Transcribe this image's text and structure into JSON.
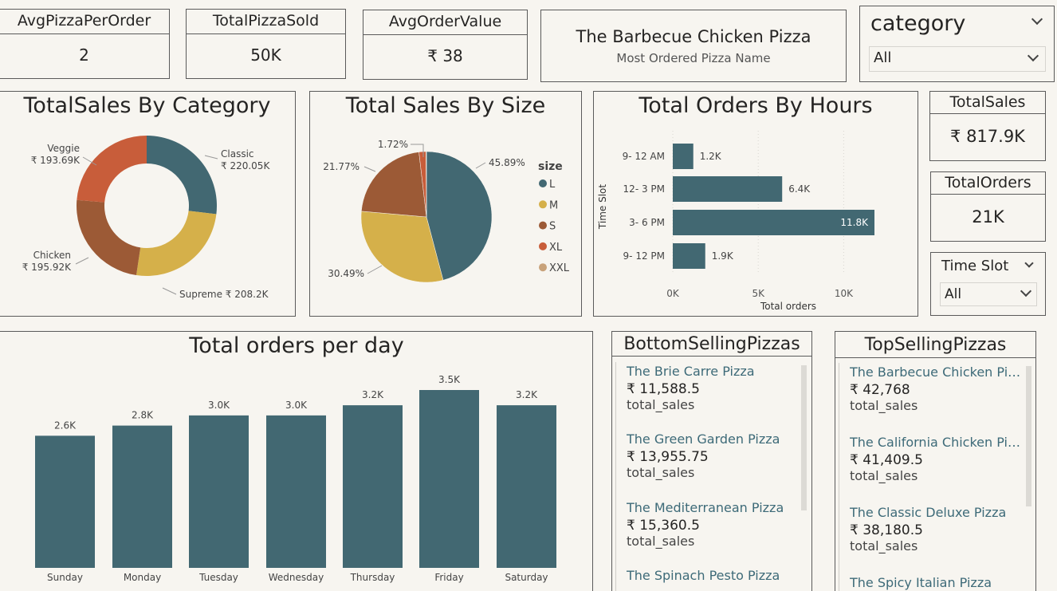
{
  "kpis": {
    "avg_pizza": {
      "label": "AvgPizzaPerOrder",
      "value": "2"
    },
    "total_pizza": {
      "label": "TotalPizzaSold",
      "value": "50K"
    },
    "avg_order": {
      "label": "AvgOrderValue",
      "value": "₹ 38"
    },
    "most_ordered": {
      "value": "The Barbecue Chicken Pizza",
      "label": "Most Ordered Pizza Name"
    },
    "total_sales": {
      "label": "TotalSales",
      "value": "₹ 817.9K"
    },
    "total_orders": {
      "label": "TotalOrders",
      "value": "21K"
    }
  },
  "filters": {
    "category": {
      "title": "category",
      "selected": "All"
    },
    "time_slot": {
      "title": "Time Slot",
      "selected": "All"
    }
  },
  "colors": {
    "teal": "#426872",
    "gold": "#d5b04a",
    "brown": "#9c5a36",
    "orange": "#c85d3a",
    "tan": "#c8a27a"
  },
  "chart_data": [
    {
      "id": "category",
      "type": "pie",
      "title": "TotalSales By Category",
      "categories": [
        "Classic",
        "Supreme",
        "Chicken",
        "Veggie"
      ],
      "values": [
        220.05,
        208.2,
        195.92,
        193.69
      ],
      "labels": [
        "₹ 220.05K",
        "₹ 208.2K",
        "₹ 195.92K",
        "₹ 193.69K"
      ],
      "colors": [
        "#426872",
        "#d5b04a",
        "#9c5a36",
        "#c85d3a"
      ]
    },
    {
      "id": "size",
      "type": "pie",
      "title": "Total Sales By Size",
      "legend_title": "size",
      "categories": [
        "L",
        "M",
        "S",
        "XL",
        "XXL"
      ],
      "values": [
        45.89,
        30.49,
        21.77,
        1.72,
        0.12
      ],
      "labels": [
        "45.89%",
        "30.49%",
        "21.77%",
        "1.72%"
      ],
      "colors": [
        "#426872",
        "#d5b04a",
        "#9c5a36",
        "#c85d3a",
        "#c8a27a"
      ]
    },
    {
      "id": "hours",
      "type": "bar",
      "orientation": "horizontal",
      "title": "Total Orders By Hours",
      "categories": [
        "9- 12 AM",
        "12- 3 PM",
        "3- 6 PM",
        "9- 12 PM"
      ],
      "values": [
        1.2,
        6.4,
        11.8,
        1.9
      ],
      "labels": [
        "1.2K",
        "6.4K",
        "11.8K",
        "1.9K"
      ],
      "xlabel": "Total orders",
      "ylabel": "Time Slot",
      "xlim": [
        0,
        12.5
      ],
      "ticks": [
        "0K",
        "5K",
        "10K"
      ]
    },
    {
      "id": "day",
      "type": "bar",
      "title": "Total orders per day",
      "categories": [
        "Sunday",
        "Monday",
        "Tuesday",
        "Wednesday",
        "Thursday",
        "Friday",
        "Saturday"
      ],
      "values": [
        2.6,
        2.8,
        3.0,
        3.0,
        3.2,
        3.5,
        3.2
      ],
      "labels": [
        "2.6K",
        "2.8K",
        "3.0K",
        "3.0K",
        "3.2K",
        "3.5K",
        "3.2K"
      ],
      "ylim": [
        0,
        3.5
      ]
    }
  ],
  "bottom_selling": {
    "title": "BottomSellingPizzas",
    "items": [
      {
        "name": "The Brie Carre Pizza",
        "value": "₹ 11,588.5",
        "label": "total_sales"
      },
      {
        "name": "The Green Garden Pizza",
        "value": "₹ 13,955.75",
        "label": "total_sales"
      },
      {
        "name": "The Mediterranean Pizza",
        "value": "₹ 15,360.5",
        "label": "total_sales"
      },
      {
        "name": "The Spinach Pesto Pizza",
        "value": "",
        "label": ""
      }
    ]
  },
  "top_selling": {
    "title": "TopSellingPizzas",
    "items": [
      {
        "name": "The Barbecue Chicken Pizza",
        "value": "₹ 42,768",
        "label": "total_sales"
      },
      {
        "name": "The California Chicken Pizza",
        "value": "₹ 41,409.5",
        "label": "total_sales"
      },
      {
        "name": "The Classic Deluxe Pizza",
        "value": "₹ 38,180.5",
        "label": "total_sales"
      },
      {
        "name": "The Spicy Italian Pizza",
        "value": "",
        "label": ""
      }
    ]
  }
}
